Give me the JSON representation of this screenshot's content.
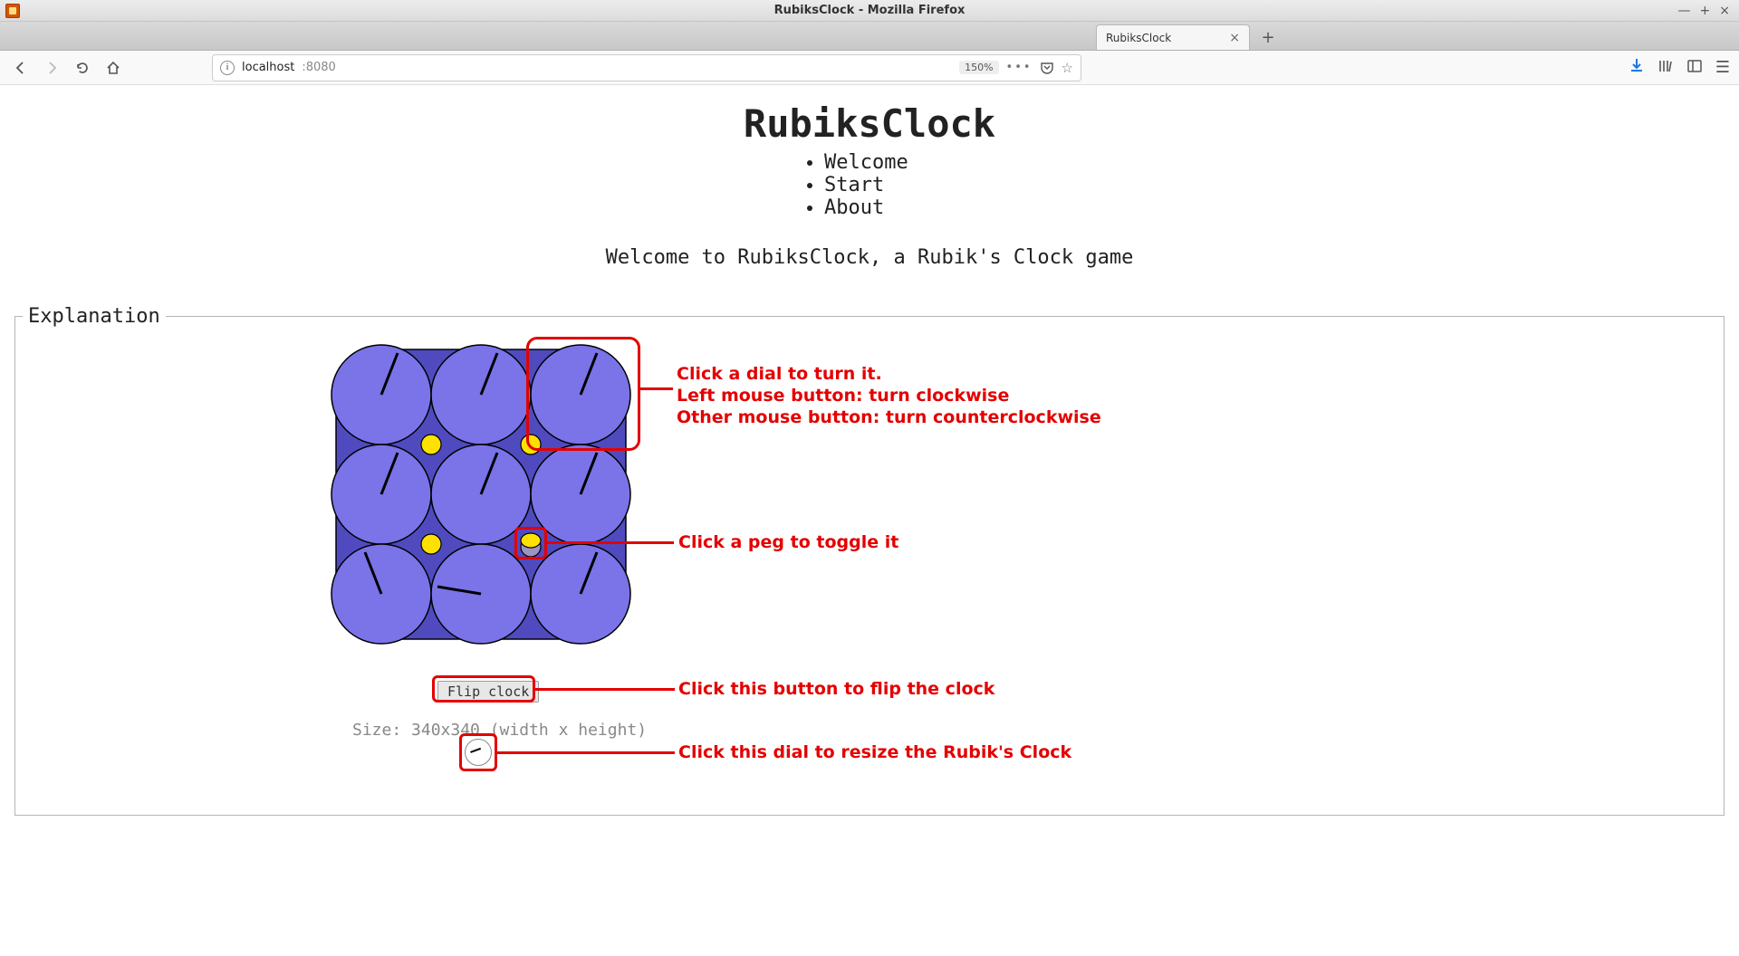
{
  "window": {
    "title": "RubiksClock - Mozilla Firefox"
  },
  "tab": {
    "label": "RubiksClock"
  },
  "urlbar": {
    "host": "localhost",
    "port": ":8080",
    "zoom": "150%"
  },
  "page": {
    "title": "RubiksClock",
    "nav": {
      "welcome": "Welcome",
      "start": "Start",
      "about": "About"
    },
    "welcome_text": "Welcome to RubiksClock, a Rubik's Clock game",
    "legend": "Explanation",
    "callout_dial_l1": "Click a dial to turn it.",
    "callout_dial_l2": "Left mouse button: turn clockwise",
    "callout_dial_l3": "Other mouse button: turn counterclockwise",
    "callout_peg": "Click a peg to toggle it",
    "flip_label": "Flip clock",
    "callout_flip": "Click this button to flip the clock",
    "size_label": "Size: 340x340 (width x height)",
    "callout_resize": "Click this dial to resize the Rubik's Clock"
  }
}
